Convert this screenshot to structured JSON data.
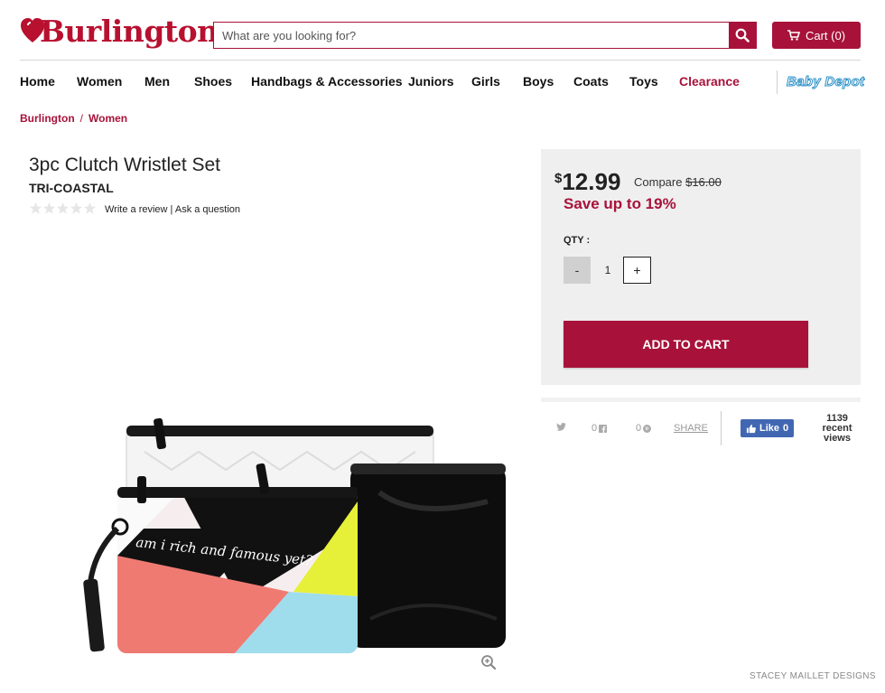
{
  "header": {
    "logo_text": "Burlington",
    "search_placeholder": "What are you looking for?",
    "cart_label": "Cart (0)"
  },
  "nav": {
    "items": [
      "Home",
      "Women",
      "Men",
      "Shoes",
      "Handbags & Accessories",
      "Juniors",
      "Girls",
      "Boys",
      "Coats",
      "Toys",
      "Clearance"
    ],
    "baby_depot_label": "Baby Depot"
  },
  "breadcrumb": [
    "Burlington",
    "Women"
  ],
  "product": {
    "title": "3pc Clutch Wristlet Set",
    "brand": "TRI-COASTAL",
    "rating": 0,
    "write_review": "Write a review",
    "ask_question": "Ask a question",
    "image_text": "am i rich and famous yet?"
  },
  "pricing": {
    "currency": "$",
    "price": "12.99",
    "compare_label": "Compare",
    "compare_price": "$16.00",
    "save_text": "Save up to 19%",
    "qty_label": "QTY :",
    "qty_value": "1",
    "minus": "-",
    "plus": "+",
    "add_to_cart": "ADD TO CART"
  },
  "social": {
    "twitter_count": "",
    "facebook_count": "0",
    "pinterest_count": "0",
    "share_label": "SHARE",
    "like_label": "Like",
    "like_count": "0",
    "views_count": "1139",
    "views_label_1": "recent",
    "views_label_2": "views"
  },
  "watermark": "STACEY MAILLET DESIGNS",
  "colors": {
    "brand": "#a8123a",
    "facebook": "#4267b2"
  }
}
